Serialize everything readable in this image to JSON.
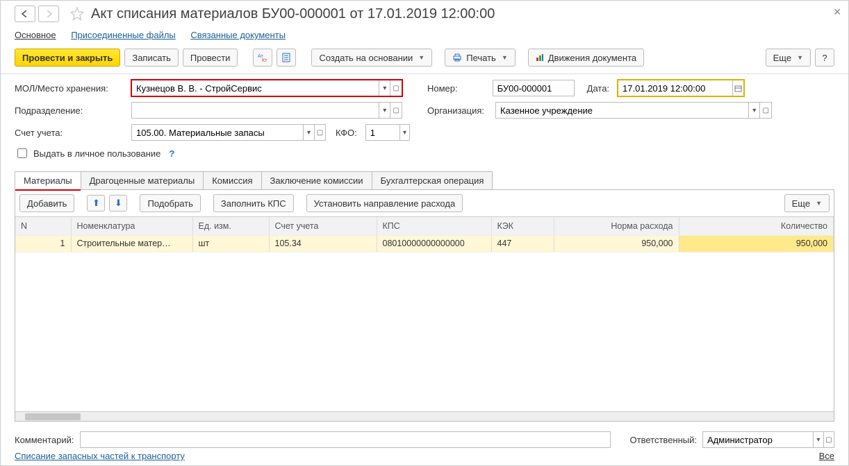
{
  "title": "Акт списания материалов БУ00-000001 от 17.01.2019 12:00:00",
  "viewtabs": {
    "main": "Основное",
    "attached": "Присоединенные файлы",
    "related": "Связанные документы"
  },
  "toolbar": {
    "postAndClose": "Провести и закрыть",
    "save": "Записать",
    "post": "Провести",
    "createBased": "Создать на основании",
    "print": "Печать",
    "movements": "Движения документа",
    "more": "Еще",
    "help": "?"
  },
  "fields": {
    "molLabel": "МОЛ/Место хранения:",
    "molValue": "Кузнецов В. В. - СтройСервис",
    "numberLabel": "Номер:",
    "numberValue": "БУ00-000001",
    "dateLabel": "Дата:",
    "dateValue": "17.01.2019 12:00:00",
    "deptLabel": "Подразделение:",
    "deptValue": "",
    "orgLabel": "Организация:",
    "orgValue": "Казенное учреждение",
    "accountLabel": "Счет учета:",
    "accountValue": "105.00. Материальные запасы",
    "kfoLabel": "КФО:",
    "kfoValue": "1",
    "personalUse": "Выдать в личное пользование"
  },
  "innertabs": {
    "materials": "Материалы",
    "precious": "Драгоценные материалы",
    "commission": "Комиссия",
    "conclusion": "Заключение комиссии",
    "accounting": "Бухгалтерская операция"
  },
  "tableToolbar": {
    "add": "Добавить",
    "pick": "Подобрать",
    "fillKps": "Заполнить КПС",
    "setDirection": "Установить направление расхода",
    "more": "Еще"
  },
  "grid": {
    "cols": {
      "n": "N",
      "nomen": "Номенклатура",
      "uom": "Ед. изм.",
      "acct": "Счет учета",
      "kps": "КПС",
      "kek": "КЭК",
      "norm": "Норма расхода",
      "qty": "Количество"
    },
    "row": {
      "n": "1",
      "nomen": "Строительные матер…",
      "uom": "шт",
      "acct": "105.34",
      "kps": "08010000000000000",
      "kek": "447",
      "norm": "950,000",
      "qty": "950,000"
    }
  },
  "footer": {
    "commentLabel": "Комментарий:",
    "commentValue": "",
    "respLabel": "Ответственный:",
    "respValue": "Администратор"
  },
  "bottomLink": "Списание запасных частей к транспорту",
  "allLabel": "Все"
}
